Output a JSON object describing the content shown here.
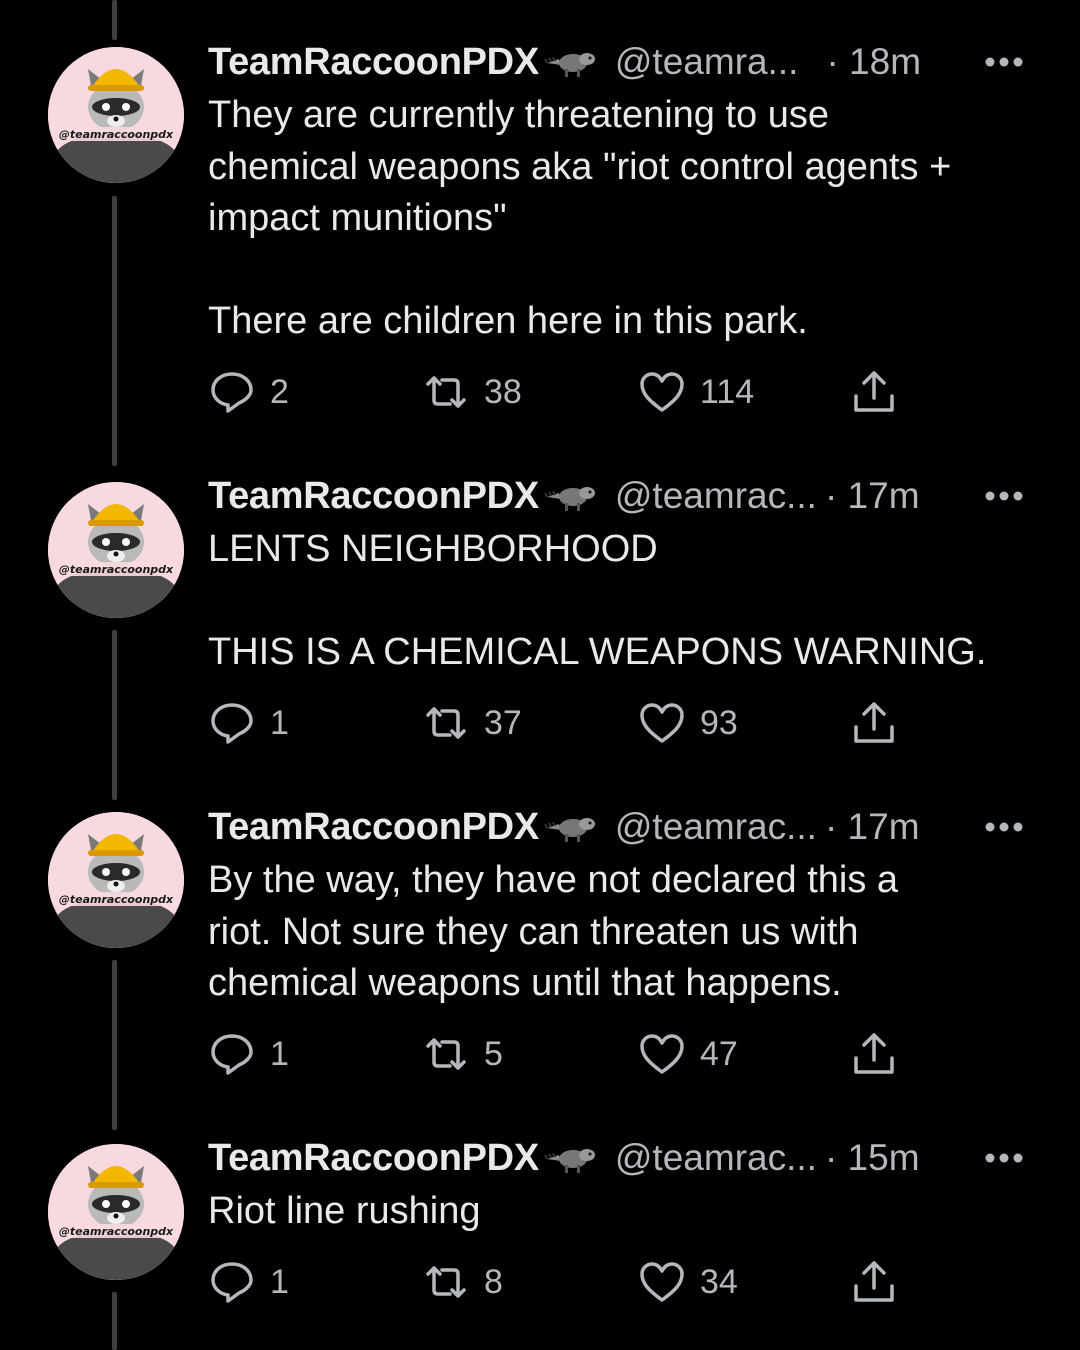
{
  "tweets": [
    {
      "display_name": "TeamRaccoonPDX",
      "handle": "@teamra...",
      "time": "· 18m",
      "text": "They are currently threatening to use\nchemical weapons aka \"riot control agents +\nimpact munitions\"\n\nThere are children here in this park.",
      "replies": "2",
      "retweets": "38",
      "likes": "114",
      "avatar_text": "@teamraccoonpdx"
    },
    {
      "display_name": "TeamRaccoonPDX",
      "handle": "@teamrac...",
      "time": "· 17m",
      "text": "LENTS NEIGHBORHOOD\n\nTHIS IS A CHEMICAL WEAPONS WARNING.",
      "replies": "1",
      "retweets": "37",
      "likes": "93",
      "avatar_text": "@teamraccoonpdx"
    },
    {
      "display_name": "TeamRaccoonPDX",
      "handle": "@teamrac...",
      "time": "· 17m",
      "text": "By the way, they have not declared this a\nriot. Not sure they can threaten us with\nchemical weapons until that happens.",
      "replies": "1",
      "retweets": "5",
      "likes": "47",
      "avatar_text": "@teamraccoonpdx"
    },
    {
      "display_name": "TeamRaccoonPDX",
      "handle": "@teamrac...",
      "time": "· 15m",
      "text": "Riot line rushing",
      "replies": "1",
      "retweets": "8",
      "likes": "34",
      "avatar_text": "@teamraccoonpdx"
    }
  ],
  "icons": {
    "reply": "reply-icon",
    "retweet": "retweet-icon",
    "like": "heart-icon",
    "share": "share-icon",
    "more": "more-icon",
    "name_emoji": "raccoon-emoji"
  },
  "colors": {
    "background": "#000000",
    "text": "#e7e9ea",
    "secondary": "#b4b8bc",
    "thread_line": "#3e4144",
    "avatar_bg": "#f7d9df"
  }
}
